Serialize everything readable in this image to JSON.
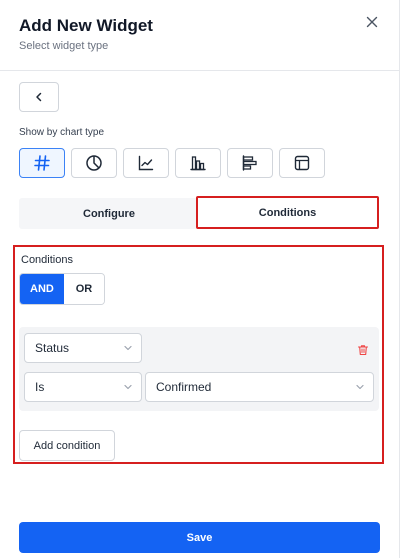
{
  "header": {
    "title": "Add New Widget",
    "subtitle": "Select widget type"
  },
  "chart_types": {
    "label": "Show by chart type",
    "items": [
      {
        "icon": "hash-icon",
        "active": true
      },
      {
        "icon": "pie-chart-icon",
        "active": false
      },
      {
        "icon": "line-chart-icon",
        "active": false
      },
      {
        "icon": "bar-chart-icon",
        "active": false
      },
      {
        "icon": "horizontal-bar-chart-icon",
        "active": false
      },
      {
        "icon": "table-icon",
        "active": false
      }
    ]
  },
  "tabs": {
    "configure": "Configure",
    "conditions": "Conditions",
    "active": "conditions"
  },
  "conditions": {
    "label": "Conditions",
    "logic_and": "AND",
    "logic_or": "OR",
    "selected_logic": "AND",
    "field": "Status",
    "operator": "Is",
    "value": "Confirmed",
    "add_label": "Add condition"
  },
  "footer": {
    "save_label": "Save"
  },
  "colors": {
    "primary": "#1463f3",
    "highlight": "#d61f1f",
    "delete": "#ef4444"
  }
}
